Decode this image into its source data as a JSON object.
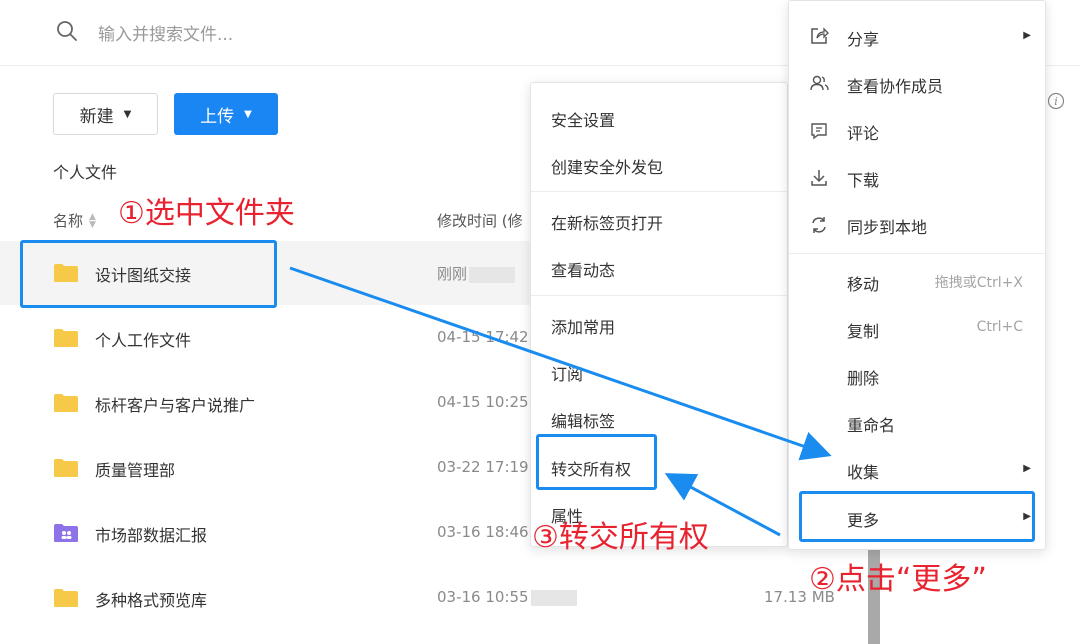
{
  "search": {
    "placeholder": "输入并搜索文件..."
  },
  "toolbar": {
    "new_label": "新建",
    "upload_label": "上传"
  },
  "breadcrumb": "个人文件",
  "columns": {
    "name": "名称",
    "modified": "修改时间 (修"
  },
  "files": [
    {
      "name": "设计图纸交接",
      "time": "刚刚",
      "type": "folder",
      "color": "#f7c948"
    },
    {
      "name": "个人工作文件",
      "time": "04-15 17:42(",
      "type": "folder",
      "color": "#f7c948"
    },
    {
      "name": "标杆客户与客户说推广",
      "time": "04-15 10:25(",
      "type": "folder",
      "color": "#f7c948"
    },
    {
      "name": "质量管理部",
      "time": "03-22 17:19(",
      "type": "folder",
      "color": "#f7c948"
    },
    {
      "name": "市场部数据汇报",
      "time": "03-16 18:46(",
      "type": "team-folder",
      "color": "#8e72e8"
    },
    {
      "name": "多种格式预览库",
      "time": "03-16 10:55",
      "type": "folder",
      "color": "#f7c948",
      "size": "17.13 MB"
    }
  ],
  "submenu": {
    "items": [
      "安全设置",
      "创建安全外发包",
      "在新标签页打开",
      "查看动态",
      "添加常用",
      "订阅",
      "编辑标签",
      "转交所有权",
      "属性"
    ]
  },
  "context_menu": {
    "share": "分享",
    "members": "查看协作成员",
    "comment": "评论",
    "download": "下载",
    "sync": "同步到本地",
    "move": "移动",
    "move_shortcut": "拖拽或Ctrl+X",
    "copy": "复制",
    "copy_shortcut": "Ctrl+C",
    "delete": "删除",
    "rename": "重命名",
    "favorite": "收集",
    "more": "更多"
  },
  "annotations": {
    "step1": "①选中文件夹",
    "step2": "②点击“更多”",
    "step3": "③转交所有权"
  },
  "colors": {
    "accent": "#1a86f3",
    "annotation_red": "#e8222e",
    "annotation_blue": "#1a8cf0"
  }
}
